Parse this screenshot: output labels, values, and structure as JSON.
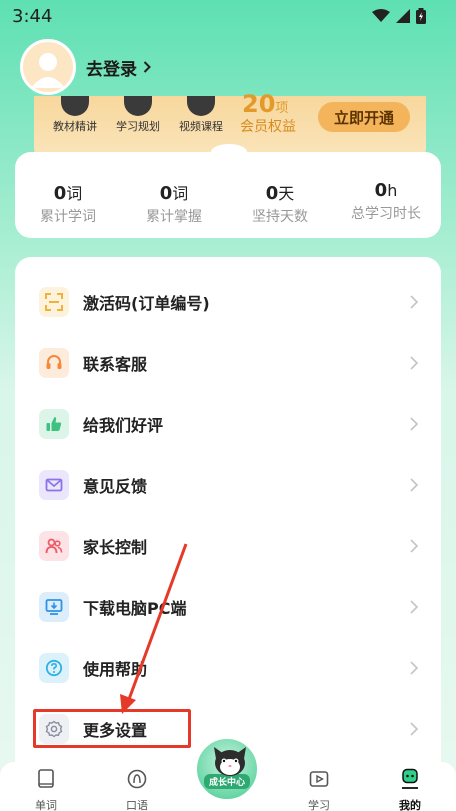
{
  "status_bar": {
    "time": "3:44"
  },
  "header": {
    "login_label": "去登录"
  },
  "member_card": {
    "features": [
      {
        "label": "教材精讲"
      },
      {
        "label": "学习规划"
      },
      {
        "label": "视频课程"
      }
    ],
    "benefit_count": "20",
    "benefit_unit": "项",
    "benefit_label": "会员权益",
    "open_button": "立即开通"
  },
  "stats": [
    {
      "value": "0",
      "unit": "词",
      "label": "累计学词"
    },
    {
      "value": "0",
      "unit": "词",
      "label": "累计掌握"
    },
    {
      "value": "0",
      "unit": "天",
      "label": "坚持天数"
    },
    {
      "value": "0",
      "unit": "h",
      "label": "总学习时长"
    }
  ],
  "menu": [
    {
      "label": "激活码(订单编号)",
      "icon": "scan-code-icon",
      "color": "#f2b23a",
      "bg": "#fdf3dc"
    },
    {
      "label": "联系客服",
      "icon": "headset-icon",
      "color": "#f28a3a",
      "bg": "#fdebdc"
    },
    {
      "label": "给我们好评",
      "icon": "thumbs-up-icon",
      "color": "#3ec27f",
      "bg": "#dcf5e8"
    },
    {
      "label": "意见反馈",
      "icon": "feedback-mail-icon",
      "color": "#8a74e8",
      "bg": "#ebe6fb"
    },
    {
      "label": "家长控制",
      "icon": "parents-icon",
      "color": "#ee5a6a",
      "bg": "#fde3e6"
    },
    {
      "label": "下载电脑PC端",
      "icon": "download-monitor-icon",
      "color": "#2f92e6",
      "bg": "#dceefb"
    },
    {
      "label": "使用帮助",
      "icon": "help-icon",
      "color": "#2fb0e6",
      "bg": "#dcf2fb"
    },
    {
      "label": "更多设置",
      "icon": "gear-icon",
      "color": "#8a8fa0",
      "bg": "#eef0f4"
    }
  ],
  "bottom_nav": {
    "items": [
      {
        "label": "单词",
        "icon": "book-icon"
      },
      {
        "label": "口语",
        "icon": "speech-icon"
      },
      {
        "label": "学习",
        "icon": "video-icon"
      },
      {
        "label": "我的",
        "icon": "profile-icon"
      }
    ],
    "center_label": "成长中心"
  },
  "colors": {
    "accent_green": "#5ee0b3",
    "annotation_red": "#e53a2a",
    "gold": "#e39a2b"
  }
}
